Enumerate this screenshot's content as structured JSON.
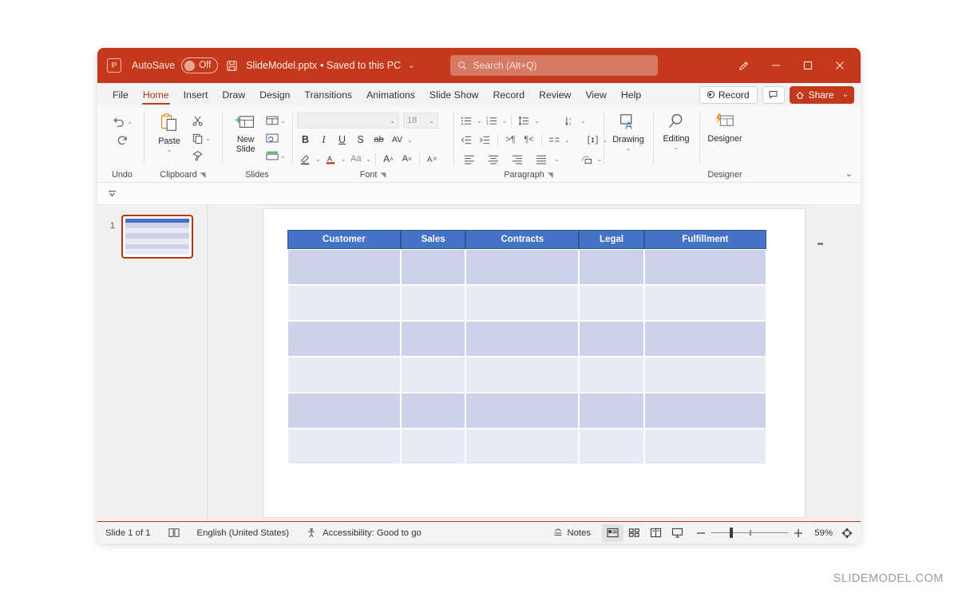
{
  "titlebar": {
    "app_icon": "powerpoint-logo-icon",
    "autosave_label": "AutoSave",
    "autosave_state": "Off",
    "save_icon": "save-disk-icon",
    "filename": "SlideModel.pptx",
    "save_status": "• Saved to this PC",
    "filename_caret": "⌄",
    "search_icon": "search-icon",
    "search_placeholder": "Search (Alt+Q)",
    "pen_icon": "ink-pen-icon",
    "minimize_icon": "minimize-icon",
    "maximize_icon": "maximize-icon",
    "close_icon": "close-icon"
  },
  "tabs": [
    {
      "label": "File",
      "active": false
    },
    {
      "label": "Home",
      "active": true
    },
    {
      "label": "Insert",
      "active": false
    },
    {
      "label": "Draw",
      "active": false
    },
    {
      "label": "Design",
      "active": false
    },
    {
      "label": "Transitions",
      "active": false
    },
    {
      "label": "Animations",
      "active": false
    },
    {
      "label": "Slide Show",
      "active": false
    },
    {
      "label": "Record",
      "active": false
    },
    {
      "label": "Review",
      "active": false
    },
    {
      "label": "View",
      "active": false
    },
    {
      "label": "Help",
      "active": false
    }
  ],
  "tabs_right": {
    "record_label": "Record",
    "comments_icon": "comment-icon",
    "share_label": "Share",
    "share_caret": "⌄"
  },
  "ribbon": {
    "collapse_caret": "⌄",
    "groups": {
      "undo": {
        "label": "Undo",
        "undo_icon": "undo-arrow-icon",
        "undo_caret": "⌄",
        "redo_icon": "redo-arrow-icon"
      },
      "clipboard": {
        "label": "Clipboard",
        "dialog_launcher": "◥",
        "paste_label": "Paste",
        "paste_caret": "⌄",
        "paste_icon": "clipboard-paste-icon",
        "cut_icon": "scissors-cut-icon",
        "copy_icon": "copy-icon",
        "copy_caret": "⌄",
        "format_painter_icon": "format-painter-brush-icon"
      },
      "slides": {
        "label": "Slides",
        "new_slide_label": "New Slide",
        "new_slide_caret": "⌄",
        "new_slide_icon": "new-slide-icon",
        "layout_icon": "slide-layout-icon",
        "layout_caret": "⌄",
        "reset_icon": "reset-slide-icon",
        "section_icon": "section-icon",
        "section_caret": "⌄"
      },
      "font": {
        "label": "Font",
        "dialog_launcher": "◥",
        "font_name_value": "",
        "font_name_caret": "⌄",
        "font_size_value": "18",
        "font_size_caret": "⌄",
        "bold": "B",
        "italic": "I",
        "underline": "U",
        "shadow": "S",
        "strikethrough": "ab",
        "character_spacing": "AV",
        "character_spacing_caret": "⌄",
        "text_highlight_icon": "text-highlight-icon",
        "text_highlight_caret": "⌄",
        "font_color_icon": "font-color-icon",
        "font_color_caret": "⌄",
        "change_case": "Aa",
        "change_case_caret": "⌄",
        "increase_size": "A",
        "decrease_size": "A",
        "clear_formatting_icon": "clear-formatting-icon"
      },
      "paragraph": {
        "label": "Paragraph",
        "dialog_launcher": "◥",
        "bullets_icon": "bullets-icon",
        "bullets_caret": "⌄",
        "numbering_icon": "numbering-icon",
        "numbering_caret": "⌄",
        "line_spacing_icon": "line-spacing-icon",
        "line_spacing_caret": "⌄",
        "text_direction_icon": "text-direction-icon",
        "text_direction_caret": "⌄",
        "decrease_indent_icon": "decrease-indent-icon",
        "increase_indent_icon": "increase-indent-icon",
        "ltr_icon": "left-to-right-icon",
        "rtl_icon": "right-to-left-icon",
        "columns_icon": "columns-icon",
        "columns_caret": "⌄",
        "align_text_icon": "align-text-box-icon",
        "align_text_caret": "⌄",
        "align_left_icon": "align-left-icon",
        "align_center_icon": "align-center-icon",
        "align_right_icon": "align-right-icon",
        "justify_icon": "justify-icon",
        "justify_caret": "⌄",
        "smartart_icon": "convert-to-smartart-icon",
        "smartart_caret": "⌄"
      },
      "drawing": {
        "label": "Drawing",
        "icon": "drawing-shapes-icon",
        "caret": "⌄"
      },
      "editing": {
        "label": "Editing",
        "icon": "editing-magnifier-icon",
        "caret": "⌄"
      },
      "designer": {
        "label": "Designer",
        "button_label": "Designer",
        "icon": "designer-sparkle-icon"
      }
    }
  },
  "qat": {
    "overflow_icon": "quick-access-overflow-icon"
  },
  "thumbnails": [
    {
      "number": "1",
      "selected": true
    }
  ],
  "slide": {
    "selection_marker": "table-selection-handle",
    "table": {
      "headers": [
        "Customer",
        "Sales",
        "Contracts",
        "Legal",
        "Fulfillment"
      ],
      "rows": [
        [
          "",
          "",
          "",
          "",
          ""
        ],
        [
          "",
          "",
          "",
          "",
          ""
        ],
        [
          "",
          "",
          "",
          "",
          ""
        ],
        [
          "",
          "",
          "",
          "",
          ""
        ],
        [
          "",
          "",
          "",
          "",
          ""
        ],
        [
          "",
          "",
          "",
          "",
          ""
        ]
      ],
      "header_bg": "#4472c4",
      "header_text_color": "#ffffff",
      "row_band_dark": "#ccd2e8",
      "row_band_light": "#e8ebf5"
    }
  },
  "statusbar": {
    "slide_count": "Slide 1 of 1",
    "layout_icon": "slide-layout-status-icon",
    "language": "English (United States)",
    "accessibility_icon": "accessibility-icon",
    "accessibility": "Accessibility: Good to go",
    "notes_icon": "notes-icon",
    "notes_label": "Notes",
    "view_normal_icon": "normal-view-icon",
    "view_sorter_icon": "slide-sorter-icon",
    "view_reading_icon": "reading-view-icon",
    "view_slideshow_icon": "slide-show-view-icon",
    "zoom_out_icon": "zoom-out-icon",
    "zoom_in_icon": "zoom-in-icon",
    "zoom_value": "59%",
    "fit_icon": "fit-slide-to-window-icon"
  },
  "watermark": "SLIDEMODEL.COM",
  "colors": {
    "brand_orange": "#c4391b",
    "table_header_blue": "#4472c4",
    "accent_text": "#b5350f"
  }
}
